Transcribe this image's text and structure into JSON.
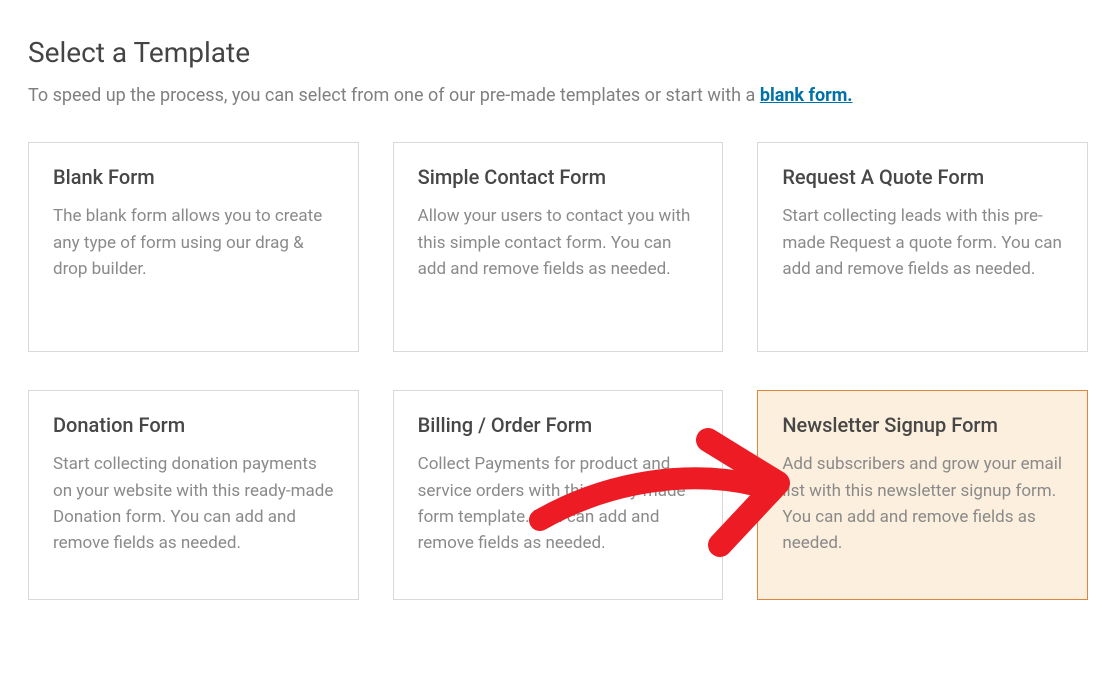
{
  "header": {
    "title": "Select a Template",
    "subtitle_pre": "To speed up the process, you can select from one of our pre-made templates or start with a ",
    "subtitle_link": "blank form."
  },
  "templates": [
    {
      "id": "blank-form",
      "title": "Blank Form",
      "description": "The blank form allows you to create any type of form using our drag & drop builder.",
      "highlighted": false
    },
    {
      "id": "simple-contact-form",
      "title": "Simple Contact Form",
      "description": "Allow your users to contact you with this simple contact form. You can add and remove fields as needed.",
      "highlighted": false
    },
    {
      "id": "request-quote-form",
      "title": "Request A Quote Form",
      "description": "Start collecting leads with this pre-made Request a quote form. You can add and remove fields as needed.",
      "highlighted": false
    },
    {
      "id": "donation-form",
      "title": "Donation Form",
      "description": "Start collecting donation payments on your website with this ready-made Donation form. You can add and remove fields as needed.",
      "highlighted": false
    },
    {
      "id": "billing-order-form",
      "title": "Billing / Order Form",
      "description": "Collect Payments for product and service orders with this ready-made form template. You can add and remove fields as needed.",
      "highlighted": false
    },
    {
      "id": "newsletter-signup-form",
      "title": "Newsletter Signup Form",
      "description": "Add subscribers and grow your email list with this newsletter signup form. You can add and remove fields as needed.",
      "highlighted": true
    }
  ],
  "annotation": {
    "icon_name": "arrow-right-icon",
    "color": "#ed1c24"
  }
}
